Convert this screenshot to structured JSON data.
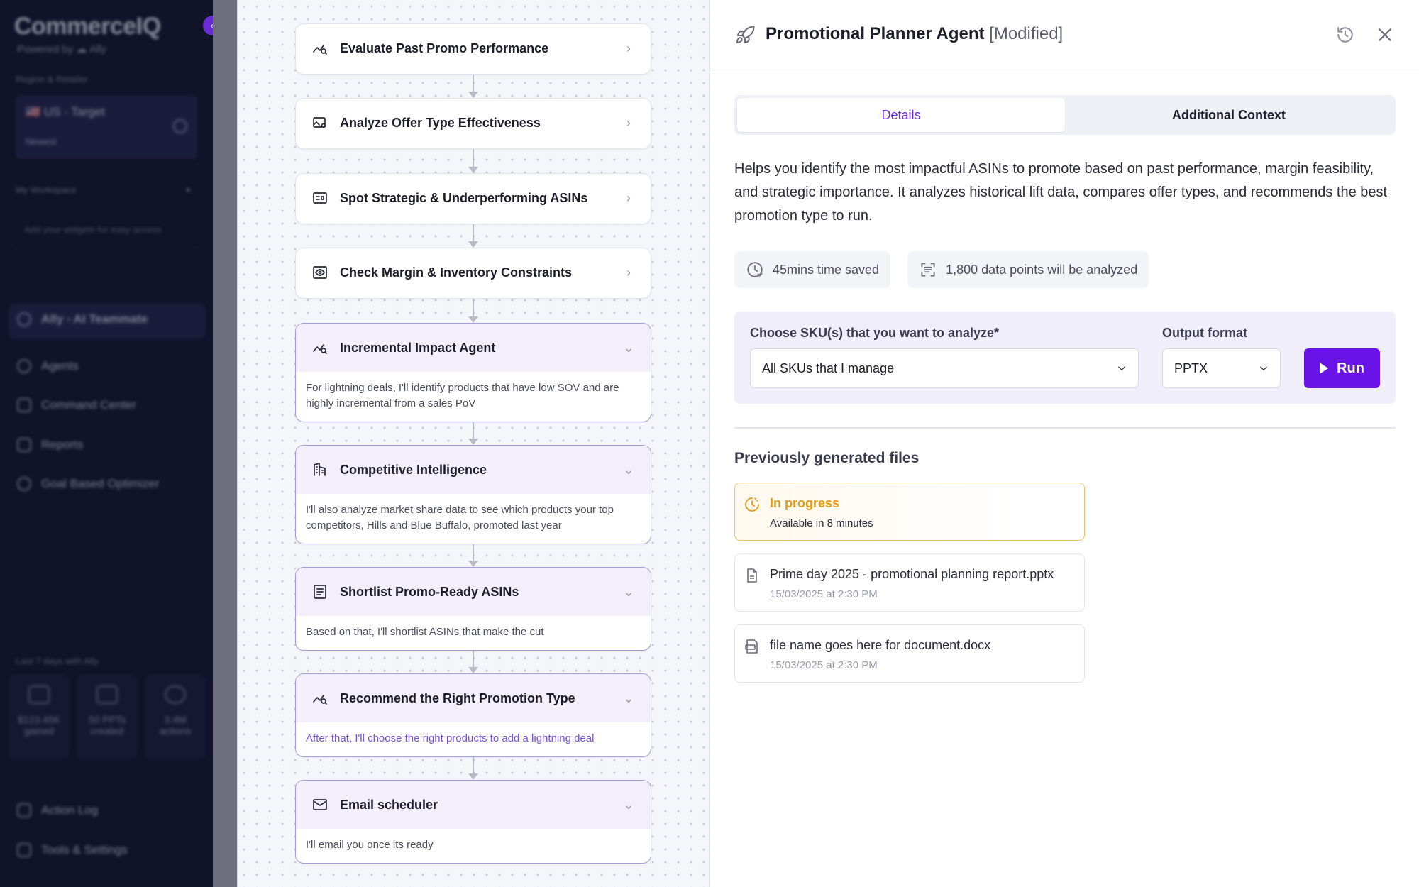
{
  "sidebar": {
    "logo": "CommerceIQ",
    "powered_by": "Powered by ☁ Ally",
    "collapse_label": "«",
    "region_label": "Region & Retailer",
    "region_value": "🇺🇸 US · Target",
    "region_sub": "Newest",
    "workspace_label": "My Workspace",
    "workspace_placeholder": "Add your widgets for easy access",
    "active_item": "Ally - AI Teammate",
    "nav": [
      "Agents",
      "Command Center",
      "Reports",
      "Goal Based Optimizer"
    ],
    "stats_label": "Last 7 days with Ally",
    "stats": [
      {
        "value": "$123.45K",
        "label": "gained"
      },
      {
        "value": "50 PPTs",
        "label": "created"
      },
      {
        "value": "3.4M",
        "label": "actions"
      }
    ],
    "bottom_nav": [
      "Action Log",
      "Tools & Settings"
    ]
  },
  "flow": {
    "steps": [
      {
        "title": "Evaluate Past Promo Performance",
        "icon": "trend-search-icon",
        "expanded": false,
        "desc": ""
      },
      {
        "title": "Analyze Offer Type Effectiveness",
        "icon": "image-gear-icon",
        "expanded": false,
        "desc": ""
      },
      {
        "title": "Spot Strategic & Underperforming ASINs",
        "icon": "id-card-icon",
        "expanded": false,
        "desc": ""
      },
      {
        "title": "Check Margin & Inventory Constraints",
        "icon": "eye-box-icon",
        "expanded": false,
        "desc": ""
      },
      {
        "title": "Incremental Impact Agent",
        "icon": "trend-search-icon",
        "expanded": true,
        "desc": "For lightning deals, I'll identify products that have low SOV and are highly incremental from a sales PoV"
      },
      {
        "title": "Competitive Intelligence",
        "icon": "building-icon",
        "expanded": true,
        "desc": "I'll also analyze market share data to see which products your top competitors, Hills and Blue Buffalo, promoted last year"
      },
      {
        "title": "Shortlist Promo-Ready ASINs",
        "icon": "list-icon",
        "expanded": true,
        "desc": "Based on that, I'll shortlist ASINs that make the cut"
      },
      {
        "title": "Recommend the Right Promotion Type",
        "icon": "trend-search-icon",
        "expanded": true,
        "desc": "After that, I'll choose the right products to add a lightning deal",
        "desc_accent": true
      },
      {
        "title": "Email scheduler",
        "icon": "mail-icon",
        "expanded": true,
        "desc": "I'll email you once its ready"
      }
    ]
  },
  "panel": {
    "title": "Promotional Planner Agent",
    "modified": "[Modified]",
    "tabs": [
      "Details",
      "Additional Context"
    ],
    "active_tab": "Details",
    "description": "Helps you identify the most impactful ASINs to promote based on past performance, margin feasibility, and strategic importance. It analyzes historical lift data, compares offer types, and recommends the best promotion type to run.",
    "chips": [
      "45mins time saved",
      "1,800 data points will be analyzed"
    ],
    "sku_label": "Choose SKU(s) that you want to analyze*",
    "sku_value": "All SKUs that I manage",
    "format_label": "Output format",
    "format_value": "PPTX",
    "run_label": "Run",
    "prev_title": "Previously generated files",
    "files": [
      {
        "name": "In progress",
        "sub": "Available in 8 minutes",
        "status": "progress"
      },
      {
        "name": "Prime day 2025 - promotional planning report.pptx",
        "sub": "15/03/2025 at 2:30 PM",
        "status": "done"
      },
      {
        "name": "file name goes here for document.docx",
        "sub": "15/03/2025 at 2:30 PM",
        "status": "done"
      }
    ]
  },
  "colors": {
    "accent": "#6a13e6",
    "progress": "#e39b14",
    "sidebar_bg": "#11132a"
  }
}
